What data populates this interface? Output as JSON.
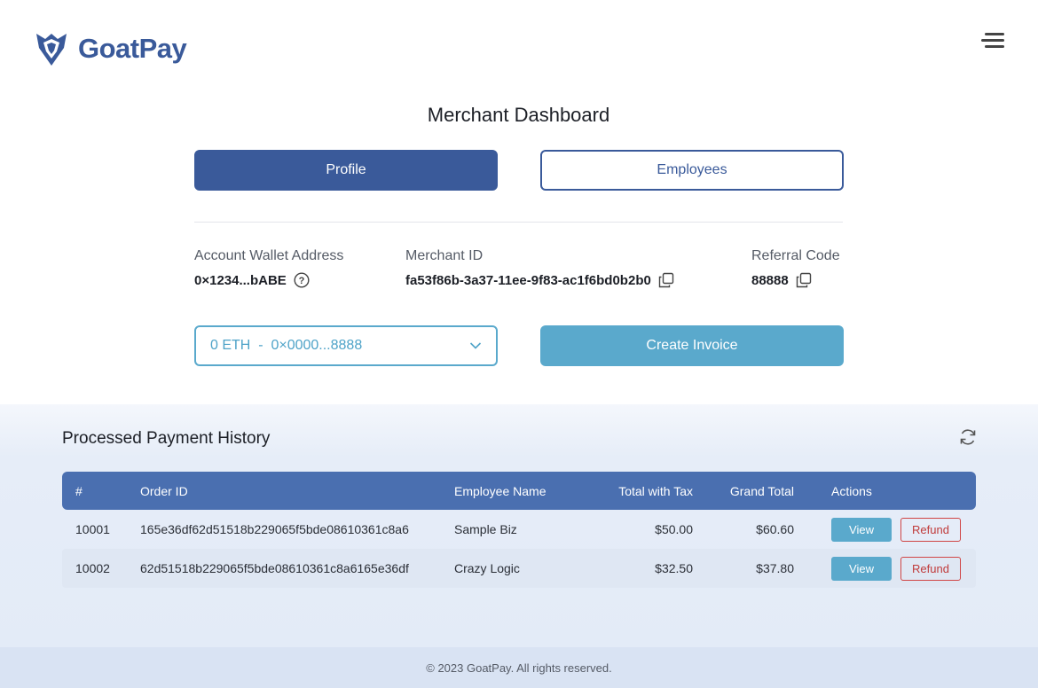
{
  "brand": {
    "name": "GoatPay"
  },
  "header": {
    "menu_icon": "hamburger-menu-icon"
  },
  "page": {
    "title": "Merchant Dashboard"
  },
  "tabs": [
    {
      "label": "Profile",
      "active": true
    },
    {
      "label": "Employees",
      "active": false
    }
  ],
  "account": {
    "wallet_label": "Account Wallet Address",
    "wallet_value": "0×1234...bABE",
    "merchant_label": "Merchant ID",
    "merchant_value": "fa53f86b-3a37-11ee-9f83-ac1f6bd0b2b0",
    "referral_label": "Referral Code",
    "referral_value": "88888"
  },
  "wallet_select": {
    "value": "0 ETH  -  0×0000...8888"
  },
  "actions": {
    "create_invoice": "Create Invoice"
  },
  "history": {
    "title": "Processed Payment History",
    "columns": [
      "#",
      "Order ID",
      "Employee Name",
      "Total with Tax",
      "Grand Total",
      "Actions"
    ],
    "rows": [
      {
        "num": "10001",
        "order_id": "165e36df62d51518b229065f5bde08610361c8a6",
        "employee": "Sample Biz",
        "total_tax": "$50.00",
        "grand_total": "$60.60",
        "view": "View",
        "refund": "Refund"
      },
      {
        "num": "10002",
        "order_id": "62d51518b229065f5bde08610361c8a6165e36df",
        "employee": "Crazy Logic",
        "total_tax": "$32.50",
        "grand_total": "$37.80",
        "view": "View",
        "refund": "Refund"
      }
    ]
  },
  "footer": {
    "text": "© 2023 GoatPay. All rights reserved."
  },
  "colors": {
    "primary": "#3a5a9a",
    "accent": "#5aa9cc",
    "danger": "#d04545",
    "table_header": "#4a6fb0"
  }
}
